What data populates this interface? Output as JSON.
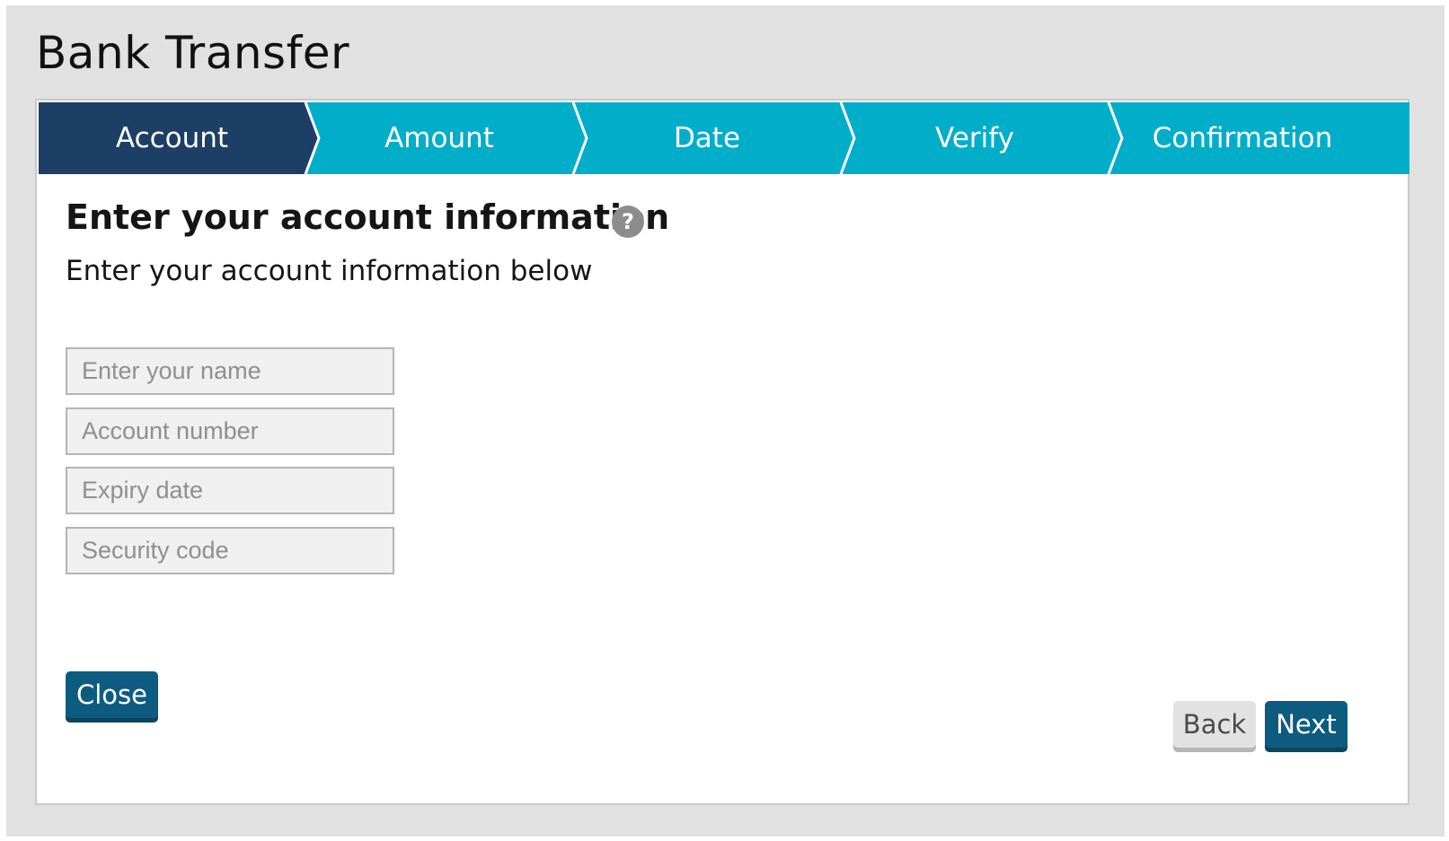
{
  "app": {
    "title": "Bank Transfer"
  },
  "wizard": {
    "active_index": 0,
    "active_color": "#1d3f66",
    "inactive_color": "#00aec9",
    "steps": [
      {
        "label": "Account"
      },
      {
        "label": "Amount"
      },
      {
        "label": "Date"
      },
      {
        "label": "Verify"
      },
      {
        "label": "Confirmation"
      }
    ]
  },
  "content": {
    "title": "Enter your account information",
    "help_icon": "question-mark-icon",
    "help_symbol": "?",
    "subtitle": "Enter your account information below"
  },
  "form": {
    "name_placeholder": "Enter your name",
    "account_number_placeholder": "Account number",
    "expiry_date_placeholder": "Expiry date",
    "security_code_placeholder": "Security code"
  },
  "buttons": {
    "close_label": "Close",
    "back_label": "Back",
    "next_label": "Next",
    "primary_color": "#0d5c80"
  }
}
